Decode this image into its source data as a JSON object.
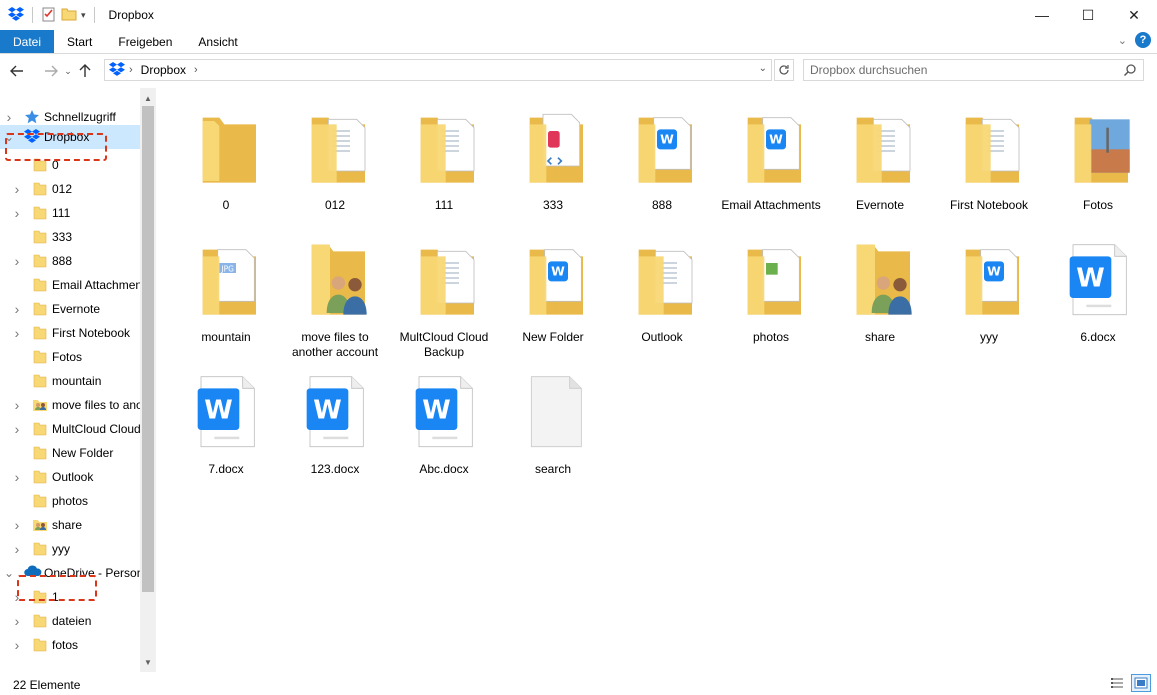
{
  "window": {
    "title": "Dropbox",
    "controls": {
      "minimize": "—",
      "maximize": "☐",
      "close": "✕"
    }
  },
  "ribbon": {
    "tabs": [
      "Datei",
      "Start",
      "Freigeben",
      "Ansicht"
    ],
    "help_label": "?"
  },
  "address": {
    "crumb": "Dropbox",
    "search_placeholder": "Dropbox durchsuchen"
  },
  "sidebar": {
    "items": [
      {
        "label": "Schnellzugriff",
        "icon": "star-icon",
        "arrow": "›",
        "level": 0
      },
      {
        "label": "Dropbox",
        "icon": "dropbox-icon",
        "arrow": "⌄",
        "level": 0,
        "selected": true
      },
      {
        "label": "0",
        "icon": "folder-icon",
        "arrow": "",
        "level": 1
      },
      {
        "label": "012",
        "icon": "folder-icon",
        "arrow": "›",
        "level": 1
      },
      {
        "label": "111",
        "icon": "folder-icon",
        "arrow": "›",
        "level": 1
      },
      {
        "label": "333",
        "icon": "folder-icon",
        "arrow": "",
        "level": 1
      },
      {
        "label": "888",
        "icon": "folder-icon",
        "arrow": "›",
        "level": 1
      },
      {
        "label": "Email Attachments",
        "icon": "folder-icon",
        "arrow": "",
        "level": 1
      },
      {
        "label": "Evernote",
        "icon": "folder-icon",
        "arrow": "›",
        "level": 1
      },
      {
        "label": "First Notebook",
        "icon": "folder-icon",
        "arrow": "›",
        "level": 1
      },
      {
        "label": "Fotos",
        "icon": "folder-icon",
        "arrow": "",
        "level": 1
      },
      {
        "label": "mountain",
        "icon": "folder-icon",
        "arrow": "",
        "level": 1
      },
      {
        "label": "move files to another account",
        "icon": "shared-folder-icon",
        "arrow": "›",
        "level": 1
      },
      {
        "label": "MultCloud Cloud Backup",
        "icon": "folder-icon",
        "arrow": "›",
        "level": 1
      },
      {
        "label": "New Folder",
        "icon": "folder-icon",
        "arrow": "",
        "level": 1
      },
      {
        "label": "Outlook",
        "icon": "folder-icon",
        "arrow": "›",
        "level": 1
      },
      {
        "label": "photos",
        "icon": "folder-icon",
        "arrow": "",
        "level": 1
      },
      {
        "label": "share",
        "icon": "shared-folder-icon",
        "arrow": "›",
        "level": 1
      },
      {
        "label": "yyy",
        "icon": "folder-icon",
        "arrow": "›",
        "level": 1
      },
      {
        "label": "OneDrive - Personal",
        "icon": "onedrive-icon",
        "arrow": "⌄",
        "level": 0
      },
      {
        "label": "1",
        "icon": "folder-icon",
        "arrow": "›",
        "level": 1
      },
      {
        "label": "dateien",
        "icon": "folder-icon",
        "arrow": "›",
        "level": 1
      },
      {
        "label": "fotos",
        "icon": "folder-icon",
        "arrow": "›",
        "level": 1
      }
    ]
  },
  "files": [
    {
      "name": "0",
      "kind": "folder-empty"
    },
    {
      "name": "012",
      "kind": "folder-docs"
    },
    {
      "name": "111",
      "kind": "folder-docs"
    },
    {
      "name": "333",
      "kind": "folder-code"
    },
    {
      "name": "888",
      "kind": "folder-word"
    },
    {
      "name": "Email Attachments",
      "kind": "folder-word"
    },
    {
      "name": "Evernote",
      "kind": "folder-docs"
    },
    {
      "name": "First Notebook",
      "kind": "folder-docs"
    },
    {
      "name": "Fotos",
      "kind": "folder-photo"
    },
    {
      "name": "mountain",
      "kind": "folder-jpg"
    },
    {
      "name": "move files to another account",
      "kind": "folder-shared"
    },
    {
      "name": "MultCloud Cloud Backup",
      "kind": "folder-docs"
    },
    {
      "name": "New Folder",
      "kind": "folder-word"
    },
    {
      "name": "Outlook",
      "kind": "folder-docs"
    },
    {
      "name": "photos",
      "kind": "folder-green"
    },
    {
      "name": "share",
      "kind": "folder-shared"
    },
    {
      "name": "yyy",
      "kind": "folder-word"
    },
    {
      "name": "6.docx",
      "kind": "docx"
    },
    {
      "name": "7.docx",
      "kind": "docx"
    },
    {
      "name": "123.docx",
      "kind": "docx"
    },
    {
      "name": "Abc.docx",
      "kind": "docx"
    },
    {
      "name": "search",
      "kind": "blank"
    }
  ],
  "status": {
    "count": "22 Elemente"
  },
  "colors": {
    "accent": "#1979ca",
    "folder": "#f8d775",
    "folder_dark": "#e9b949",
    "word": "#1a86f3",
    "highlight": "#d9361a"
  }
}
